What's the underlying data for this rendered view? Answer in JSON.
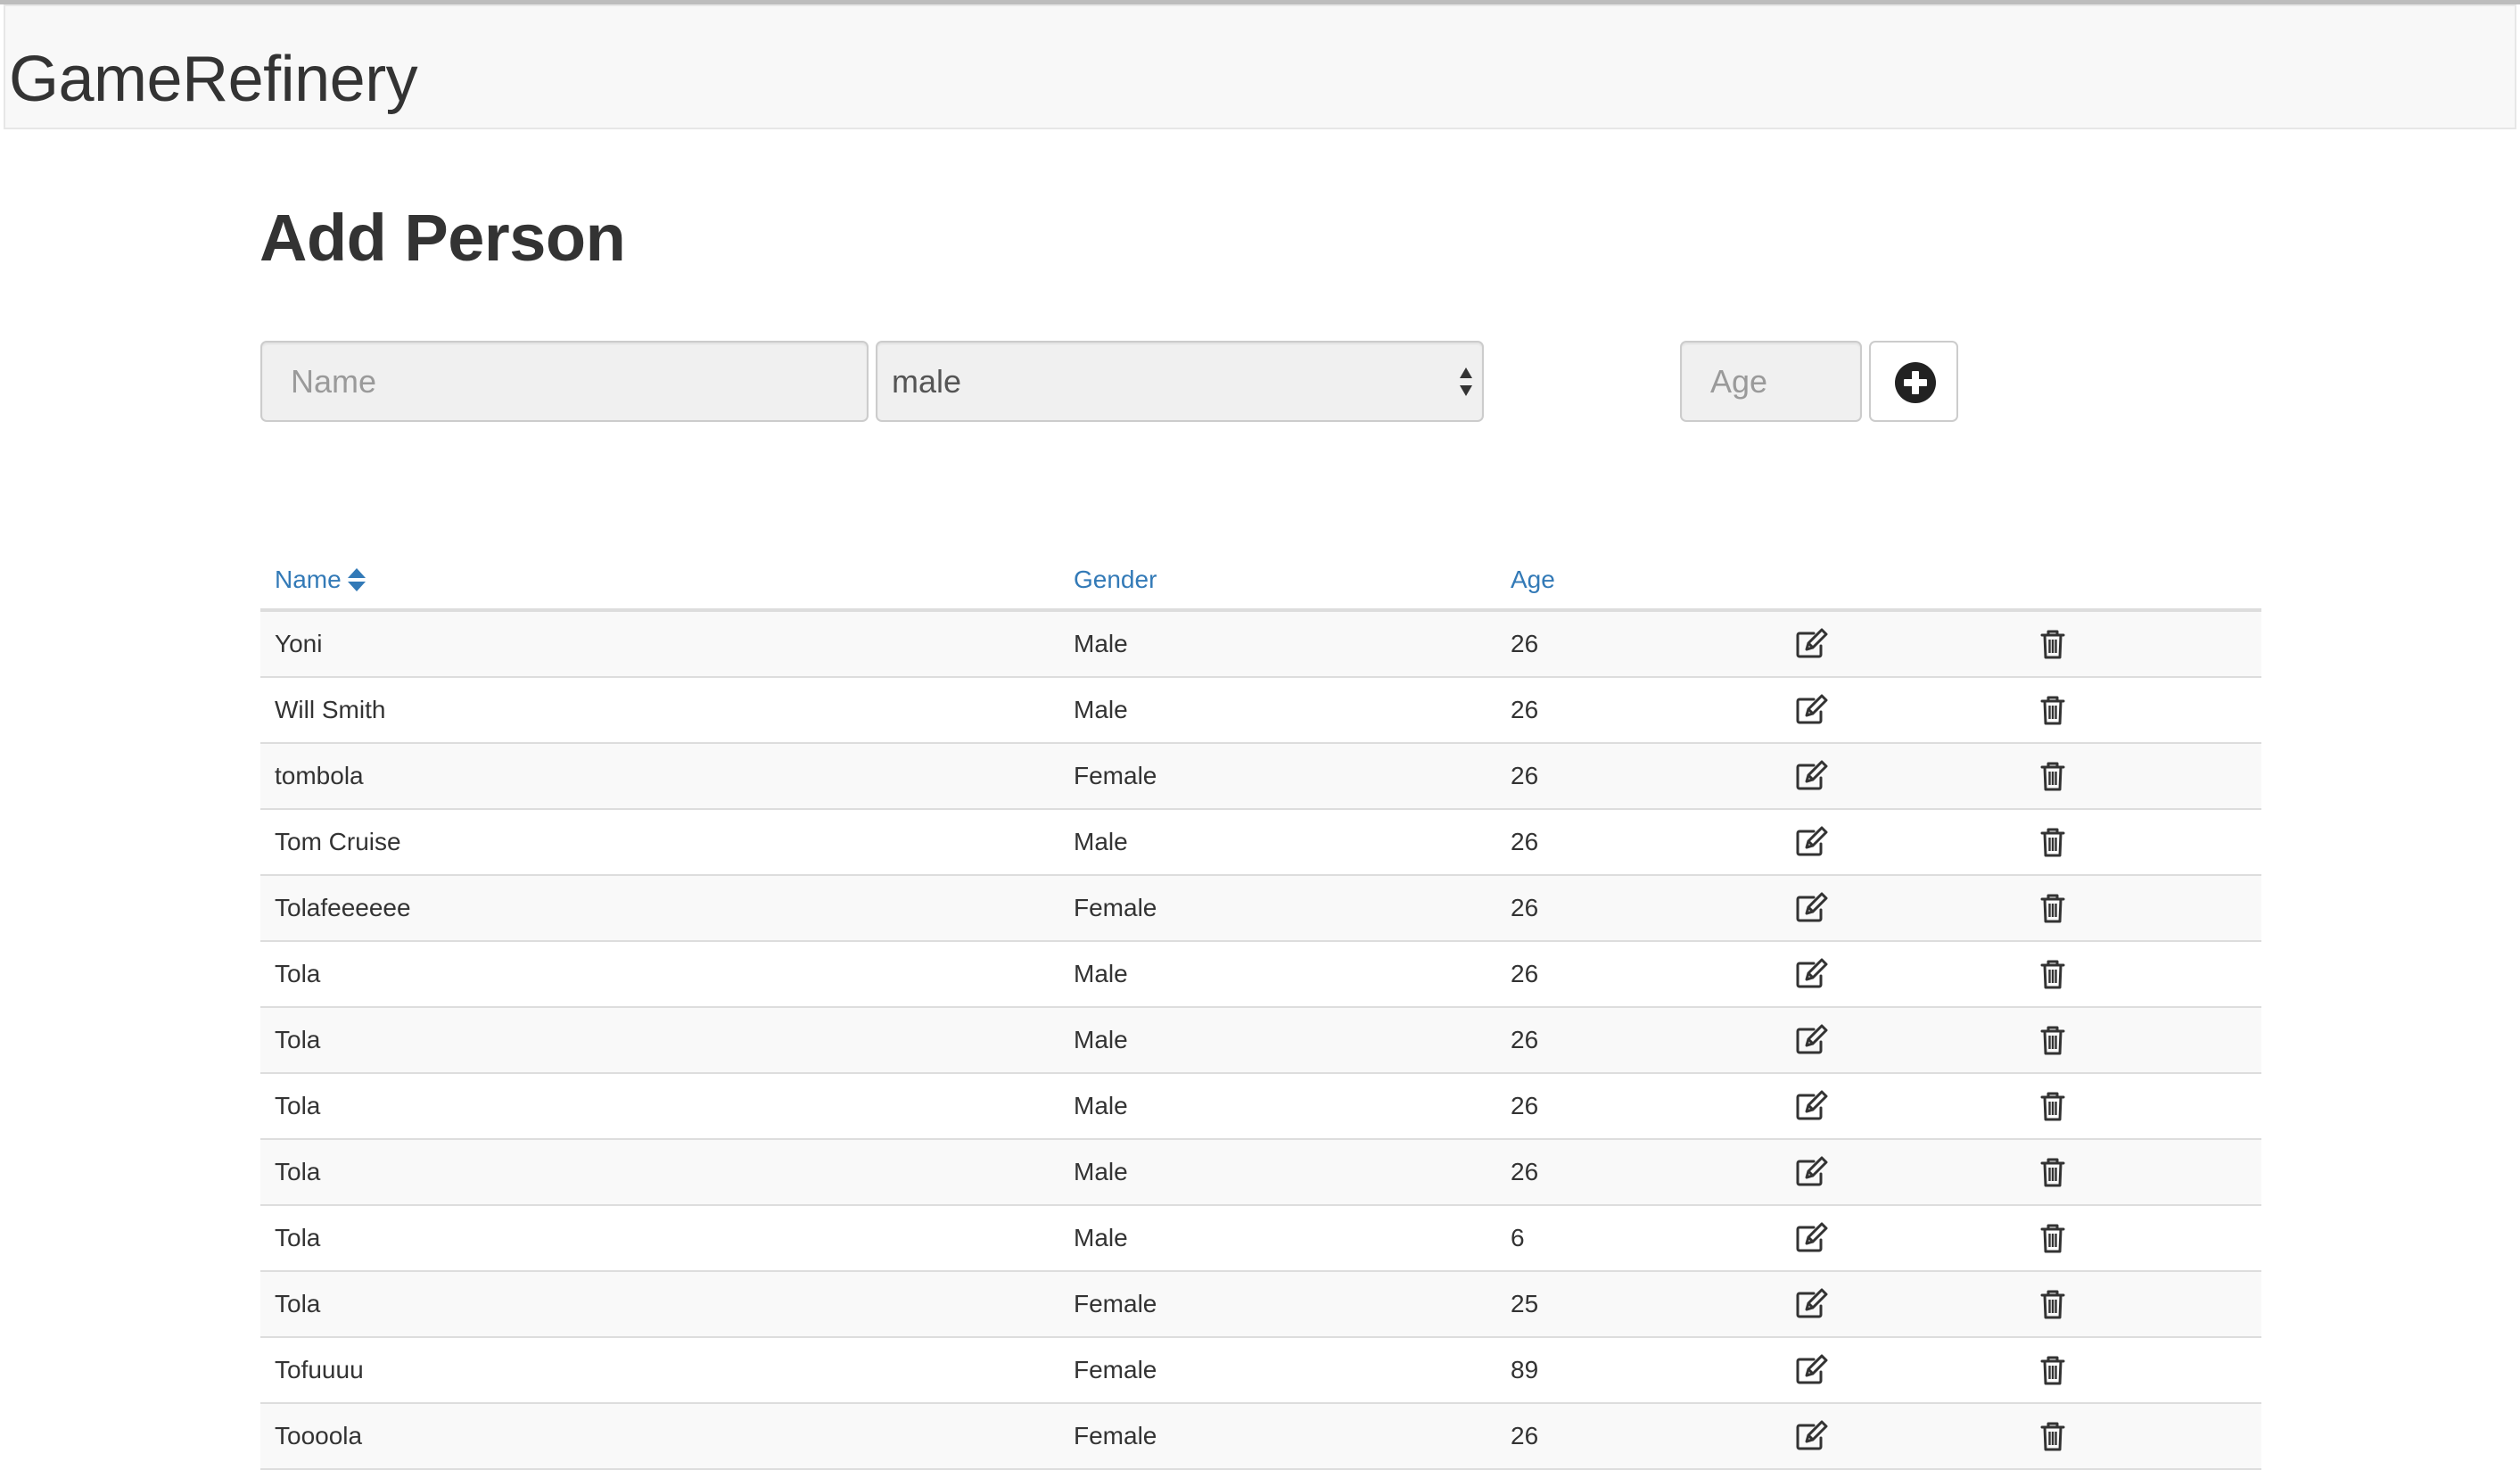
{
  "app": {
    "brand": "GameRefinery"
  },
  "form": {
    "title": "Add Person",
    "name_placeholder": "Name",
    "gender_options": [
      "male"
    ],
    "gender_selected": "male",
    "age_placeholder": "Age",
    "add_icon": "plus-circle-icon"
  },
  "table": {
    "headers": {
      "name": "Name",
      "gender": "Gender",
      "age": "Age"
    },
    "sort_icon": "sort-icon",
    "edit_icon": "edit-icon",
    "delete_icon": "trash-icon",
    "rows": [
      {
        "name": "Yoni",
        "gender": "Male",
        "age": "26"
      },
      {
        "name": "Will Smith",
        "gender": "Male",
        "age": "26"
      },
      {
        "name": "tombola",
        "gender": "Female",
        "age": "26"
      },
      {
        "name": "Tom Cruise",
        "gender": "Male",
        "age": "26"
      },
      {
        "name": "Tolafeeeeee",
        "gender": "Female",
        "age": "26"
      },
      {
        "name": "Tola",
        "gender": "Male",
        "age": "26"
      },
      {
        "name": "Tola",
        "gender": "Male",
        "age": "26"
      },
      {
        "name": "Tola",
        "gender": "Male",
        "age": "26"
      },
      {
        "name": "Tola",
        "gender": "Male",
        "age": "26"
      },
      {
        "name": "Tola",
        "gender": "Male",
        "age": "6"
      },
      {
        "name": "Tola",
        "gender": "Female",
        "age": "25"
      },
      {
        "name": "Tofuuuu",
        "gender": "Female",
        "age": "89"
      },
      {
        "name": "Toooola",
        "gender": "Female",
        "age": "26"
      }
    ]
  }
}
